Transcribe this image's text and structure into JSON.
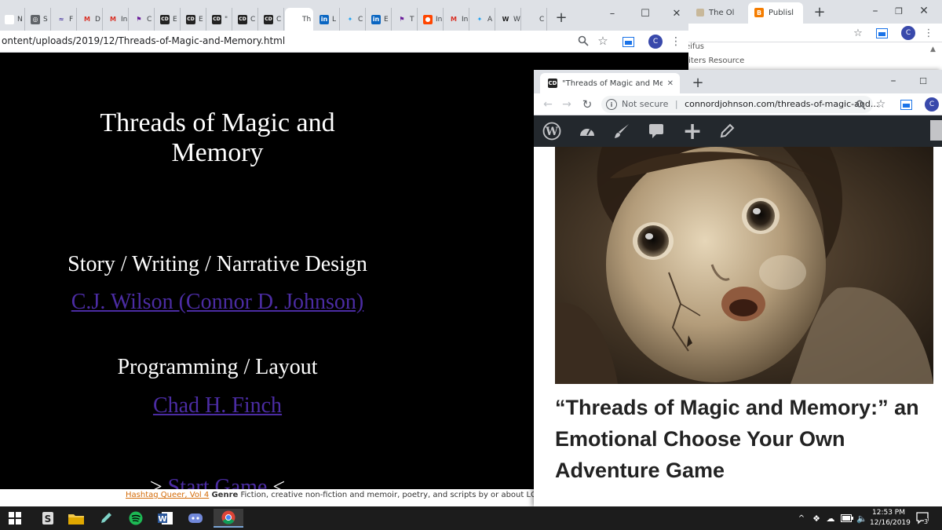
{
  "back_window": {
    "tabs": [
      {
        "label": "The Ol",
        "icon": "the-ol-favicon"
      },
      {
        "label": "Publisl",
        "icon": "blogger-icon"
      }
    ],
    "profile_initial": "C",
    "content_lines": [
      "eifus",
      "riters Resource"
    ]
  },
  "main_window": {
    "tabs": [
      {
        "label": "N",
        "icon": "generic-icon"
      },
      {
        "label": "S",
        "icon": "globe-icon"
      },
      {
        "label": "F",
        "icon": "swoosh-icon"
      },
      {
        "label": "D",
        "icon": "gmail-icon"
      },
      {
        "label": "In",
        "icon": "gmail-icon"
      },
      {
        "label": "C",
        "icon": "pennant-icon"
      },
      {
        "label": "E",
        "icon": "cd-icon"
      },
      {
        "label": "E",
        "icon": "cd-icon"
      },
      {
        "label": "\"",
        "icon": "cd-icon"
      },
      {
        "label": "C",
        "icon": "cd-icon"
      },
      {
        "label": "C",
        "icon": "cd-icon"
      },
      {
        "label": "Th",
        "icon": "blank-icon"
      },
      {
        "label": "L",
        "icon": "linkedin-icon"
      },
      {
        "label": "C",
        "icon": "twitter-icon"
      },
      {
        "label": "E",
        "icon": "linkedin-icon"
      },
      {
        "label": "T",
        "icon": "pennant-icon"
      },
      {
        "label": "In",
        "icon": "reddit-icon"
      },
      {
        "label": "In",
        "icon": "gmail-icon"
      },
      {
        "label": "A",
        "icon": "twitter-icon"
      },
      {
        "label": "W",
        "icon": "wikipedia-icon"
      },
      {
        "label": "C",
        "icon": "blank-icon"
      }
    ],
    "active_tab_index": 11,
    "url": "ontent/uploads/2019/12/Threads-of-Magic-and-Memory.html",
    "profile_initial": "C",
    "page": {
      "title_line1": "Threads of Magic and",
      "title_line2": "Memory",
      "story_heading": "Story / Writing / Narrative Design",
      "story_credit": "C.J. Wilson (Connor D. Johnson)",
      "programming_heading": "Programming / Layout",
      "programming_credit": "Chad H. Finch",
      "start_link": "Start Game"
    },
    "bottom_strip": {
      "link": "Hashtag Queer, Vol 4",
      "label": "Genre",
      "text": "Fiction, creative non-fiction and memoir, poetry, and scripts by or about LGBTQ+"
    }
  },
  "front_window": {
    "tab_title": "\"Threads of Magic and Memory:",
    "security": "Not secure",
    "url": "connordjohnson.com/threads-of-magic-and...",
    "profile_initial": "C",
    "post_title": "“Threads of Magic and Memory:” an Emotional Choose Your Own Adventure Game"
  },
  "taskbar": {
    "apps": [
      "start-icon",
      "search-icon",
      "file-explorer-icon",
      "edit-icon",
      "spotify-icon",
      "word-icon",
      "discord-icon",
      "chrome-icon"
    ],
    "time": "12:53 PM",
    "date": "12/16/2019",
    "notification_count": "3"
  },
  "colors": {
    "link_purple": "#4b2ca3",
    "wp_bar": "#23282d",
    "taskbar": "#1c1c1c",
    "tab_strip": "#dee1e6"
  }
}
